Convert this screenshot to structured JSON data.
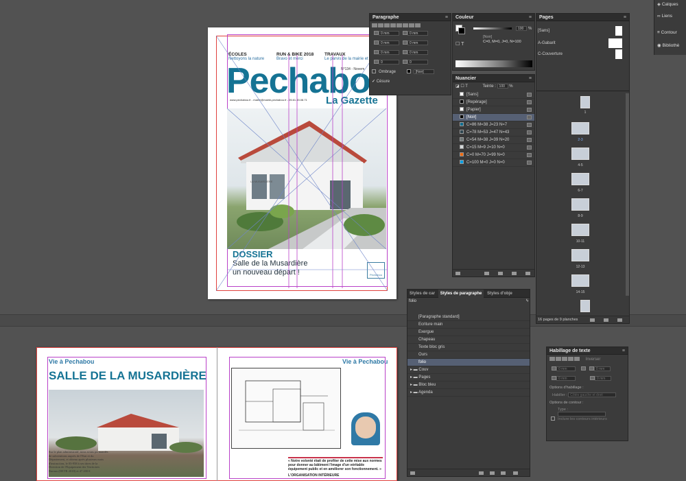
{
  "right_strip": {
    "items": [
      {
        "label": "Calques",
        "icon": "layers-icon"
      },
      {
        "label": "Liens",
        "icon": "links-icon"
      },
      {
        "label": "Contour",
        "icon": "stroke-icon"
      },
      {
        "label": "Bibliothè",
        "icon": "cc-libraries-icon"
      }
    ]
  },
  "cover": {
    "header_cols": [
      {
        "title": "ÉCOLES",
        "sub": "Nettoyons la nature"
      },
      {
        "title": "RUN & BIKE 2018",
        "sub": "Bravo et merci"
      },
      {
        "title": "TRAVAUX",
        "sub": "Le parvis de la mairie et"
      }
    ],
    "masthead": "Pechabou",
    "gazette": "La Gazette",
    "issue": "N°134 - Novem",
    "contact": "www.pechabou.fr - mairie@mairie-pechabou.fr - 05.61.45.08.71",
    "building_sign": "LA MUSARDIÈRE",
    "dossier_label": "DOSSIER",
    "dossier_line1": "Salle de la Musardière",
    "dossier_line2": "un nouveau départ !",
    "logo_caption": "Pechabou"
  },
  "spread": {
    "left_folio": "Vie à Pechabou",
    "right_folio": "Vie à Pechabou",
    "headline": "SALLE DE LA MUSARDIÈRE",
    "body_text": "Sur le plan administratif, nous avons pu mandés de subventions auprès de l'Etat et du Département, et obtenu après plusieurs mois d'instruction, le 03-958 à ses titres de la Direction de l'Equipement des Territoires Ruraux (DETR 2018) et 47 200 €",
    "quote_text": "« Notre volonté était de profiter de cette mise aux normes pour donner au bâtiment l'image d'un véritable équipement public et en améliorer son fonctionnement. »",
    "org_heading": "L'ORGANISATION INTÉRIEURE"
  },
  "paragraphe": {
    "title": "Paragraphe",
    "fields": [
      "0 mm",
      "0 mm",
      "0 mm",
      "0 mm",
      "0 mm",
      "0 mm",
      "0",
      "0"
    ],
    "shading_label": "Ombrage",
    "shading_value": "[Noir]",
    "hyphenate_label": "Césure"
  },
  "couleur": {
    "title": "Couleur",
    "tint": "100",
    "unit": "%",
    "swatch_name": "[Noir]",
    "swatch_values": "C=0, M=0, J=0, N=100"
  },
  "pages": {
    "title": "Pages",
    "masters": [
      {
        "name": "[Sans]"
      },
      {
        "name": "A-Gabarit"
      },
      {
        "name": "C-Couverture"
      }
    ],
    "page_labels": [
      "1",
      "2-3",
      "4-5",
      "6-7",
      "8-9",
      "10-11",
      "12-13",
      "14-15"
    ],
    "status": "16 pages de 9 planches"
  },
  "nuancier": {
    "title": "Nuancier",
    "tint_label": "Teinte :",
    "tint": "100",
    "unit": "%",
    "swatches": [
      {
        "name": "[Sans]",
        "color": "#ffffff"
      },
      {
        "name": "[Repérage]",
        "color": "#000000"
      },
      {
        "name": "[Papier]",
        "color": "#ffffff"
      },
      {
        "name": "[Noir]",
        "color": "#000000"
      },
      {
        "name": "C=86 M=38 J=23 N=7",
        "color": "#0f6d8f"
      },
      {
        "name": "C=78 M=53 J=47 N=43",
        "color": "#2f4650"
      },
      {
        "name": "C=54 M=38 J=39 N=20",
        "color": "#6f7777"
      },
      {
        "name": "C=15 M=9 J=10 N=0",
        "color": "#d6dadb"
      },
      {
        "name": "C=0 M=70 J=99 N=0",
        "color": "#ef6a10"
      },
      {
        "name": "C=100 M=0 J=0 N=0",
        "color": "#009fe3"
      }
    ]
  },
  "styles": {
    "tabs": [
      "Styles de car",
      "Styles de paragraphe",
      "Styles d'obje"
    ],
    "current": "folio",
    "items": [
      "[Paragraphe standard]",
      "Ecriture main",
      "Exergue",
      "Chapeau",
      "Texte bloc gris",
      "Ours",
      "folio"
    ],
    "groups": [
      "Couv",
      "Pages",
      "Bloc bleu",
      "Agenda"
    ]
  },
  "habillage": {
    "title": "Habillage de texte",
    "invert_label": "Inverser",
    "offsets": [
      "0 mm",
      "0 mm",
      "0 mm",
      "0 mm"
    ],
    "wrap_options_label": "Options d'habillage :",
    "wrap_to_label": "Habiller :",
    "wrap_to_value": "Côtés gauche et droit",
    "contour_label": "Options de contour :",
    "type_label": "Type :",
    "inner_label": "Inclure les contours intérieurs"
  }
}
